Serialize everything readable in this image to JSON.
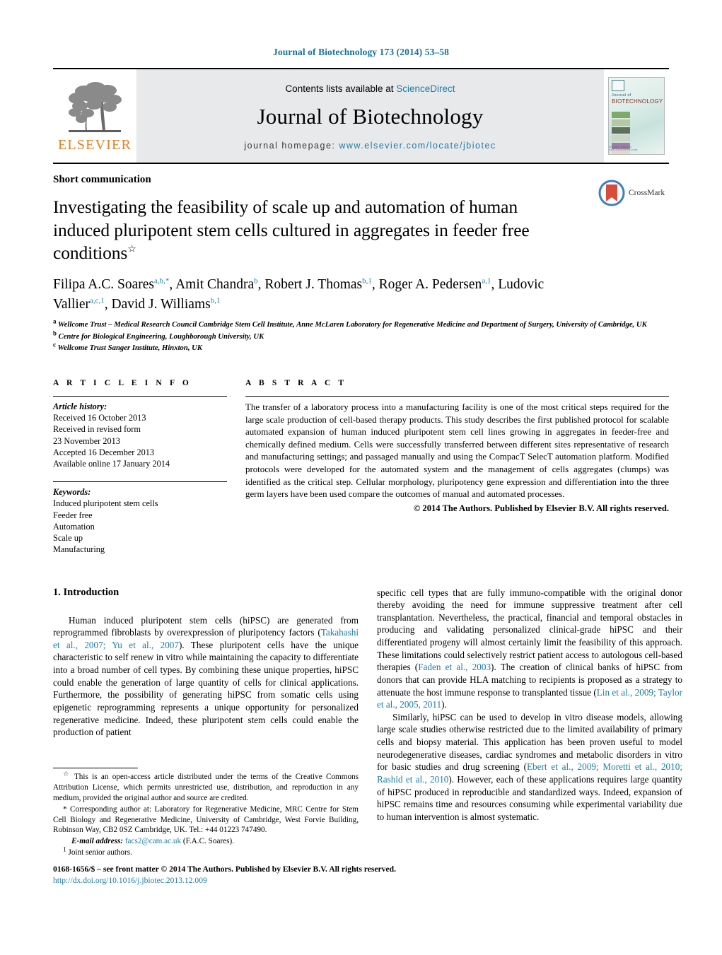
{
  "running_head": "Journal of Biotechnology 173 (2014) 53–58",
  "masthead": {
    "publisher_name": "ELSEVIER",
    "contents_prefix": "Contents lists available at ",
    "contents_link": "ScienceDirect",
    "journal_name": "Journal of Biotechnology",
    "homepage_label": "journal homepage:",
    "homepage_url": "www.elsevier.com/locate/jbiotec",
    "cover": {
      "line1": "Journal of",
      "line2": "BIOTECHNOLOGY",
      "footer": "available online at www.sciencedirect.com"
    }
  },
  "article": {
    "doctype": "Short communication",
    "title": "Investigating the feasibility of scale up and automation of human induced pluripotent stem cells cultured in aggregates in feeder free conditions",
    "title_footnote_marker": "☆",
    "crossmark_label": "CrossMark",
    "authors_html": "Filipa A.C. Soares<sup>a,b,</sup><sup>*</sup>, Amit Chandra<sup>b</sup>, Robert J. Thomas<sup>b,1</sup>, Roger A. Pedersen<sup>a,1</sup>, Ludovic Vallier<sup>a,c,1</sup>, David J. Williams<sup>b,1</sup>",
    "affiliations": [
      {
        "marker": "a",
        "text": "Wellcome Trust – Medical Research Council Cambridge Stem Cell Institute, Anne McLaren Laboratory for Regenerative Medicine and Department of Surgery, University of Cambridge, UK"
      },
      {
        "marker": "b",
        "text": "Centre for Biological Engineering, Loughborough University, UK"
      },
      {
        "marker": "c",
        "text": "Wellcome Trust Sanger Institute, Hinxton, UK"
      }
    ]
  },
  "article_info": {
    "heading": "A R T I C L E    I N F O",
    "history_label": "Article history:",
    "history": [
      "Received 16 October 2013",
      "Received in revised form",
      "23 November 2013",
      "Accepted 16 December 2013",
      "Available online 17 January 2014"
    ],
    "keywords_label": "Keywords:",
    "keywords": [
      "Induced pluripotent stem cells",
      "Feeder free",
      "Automation",
      "Scale up",
      "Manufacturing"
    ]
  },
  "abstract": {
    "heading": "A B S T R A C T",
    "text": "The transfer of a laboratory process into a manufacturing facility is one of the most critical steps required for the large scale production of cell-based therapy products. This study describes the first published protocol for scalable automated expansion of human induced pluripotent stem cell lines growing in aggregates in feeder-free and chemically defined medium. Cells were successfully transferred between different sites representative of research and manufacturing settings; and passaged manually and using the CompacT SelecT automation platform. Modified protocols were developed for the automated system and the management of cells aggregates (clumps) was identified as the critical step. Cellular morphology, pluripotency gene expression and differentiation into the three germ layers have been used compare the outcomes of manual and automated processes.",
    "copyright": "© 2014 The Authors. Published by Elsevier B.V. All rights reserved."
  },
  "introduction": {
    "section_title": "1.  Introduction",
    "left_paragraph_1_a": "Human induced pluripotent stem cells (hiPSC) are generated from reprogrammed fibroblasts by overexpression of pluripotency factors (",
    "left_citation_1": "Takahashi et al., 2007; Yu et al., 2007",
    "left_paragraph_1_b": "). These pluripotent cells have the unique characteristic to self renew in vitro while maintaining the capacity to differentiate into a broad number of cell types. By combining these unique properties, hiPSC could enable the generation of large quantity of cells for clinical applications. Furthermore, the possibility of generating hiPSC from somatic cells using epigenetic reprogramming represents a unique opportunity for personalized regenerative medicine. Indeed, these pluripotent stem cells could enable the production of patient",
    "right_p1_a": "specific cell types that are fully immuno-compatible with the original donor thereby avoiding the need for immune suppressive treatment after cell transplantation. Nevertheless, the practical, financial and temporal obstacles in producing and validating personalized clinical-grade hiPSC and their differentiated progeny will almost certainly limit the feasibility of this approach. These limitations could selectively restrict patient access to autologous cell-based therapies (",
    "right_cite_1": "Faden et al., 2003",
    "right_p1_b": "). The creation of clinical banks of hiPSC from donors that can provide HLA matching to recipients is proposed as a strategy to attenuate the host immune response to transplanted tissue (",
    "right_cite_2": "Lin et al., 2009; Taylor et al., 2005, 2011",
    "right_p1_c": ").",
    "right_p2_a": "Similarly, hiPSC can be used to develop in vitro disease models, allowing large scale studies otherwise restricted due to the limited availability of primary cells and biopsy material. This application has been proven useful to model neurodegenerative diseases, cardiac syndromes and metabolic disorders in vitro for basic studies and drug screening (",
    "right_cite_3": "Ebert et al., 2009; Moretti et al., 2010; Rashid et al., 2010",
    "right_p2_b": "). However, each of these applications requires large quantity of hiPSC produced in reproducible and standardized ways. Indeed, expansion of hiPSC remains time and resources consuming while experimental variability due to human intervention is almost systematic."
  },
  "footnotes": {
    "star_marker": "☆",
    "star_text": "This is an open-access article distributed under the terms of the Creative Commons Attribution License, which permits unrestricted use, distribution, and reproduction in any medium, provided the original author and source are credited.",
    "corr_marker": "*",
    "corr_text": "Corresponding author at: Laboratory for Regenerative Medicine, MRC Centre for Stem Cell Biology and Regenerative Medicine, University of Cambridge, West Forvie Building, Robinson Way, CB2 0SZ Cambridge, UK. Tel.: +44 01223 747490.",
    "email_label": "E-mail address:",
    "email": "facs2@cam.ac.uk",
    "email_suffix": " (F.A.C. Soares).",
    "joint_marker": "1",
    "joint_text": "Joint senior authors."
  },
  "bottom": {
    "front_matter": "0168-1656/$ – see front matter © 2014 The Authors. Published by Elsevier B.V. All rights reserved.",
    "doi": "http://dx.doi.org/10.1016/j.jbiotec.2013.12.009"
  },
  "colors": {
    "link_blue": "#1c7ca8",
    "elsevier_orange": "#ef7c20",
    "masthead_gray": "#e8e9eb"
  }
}
